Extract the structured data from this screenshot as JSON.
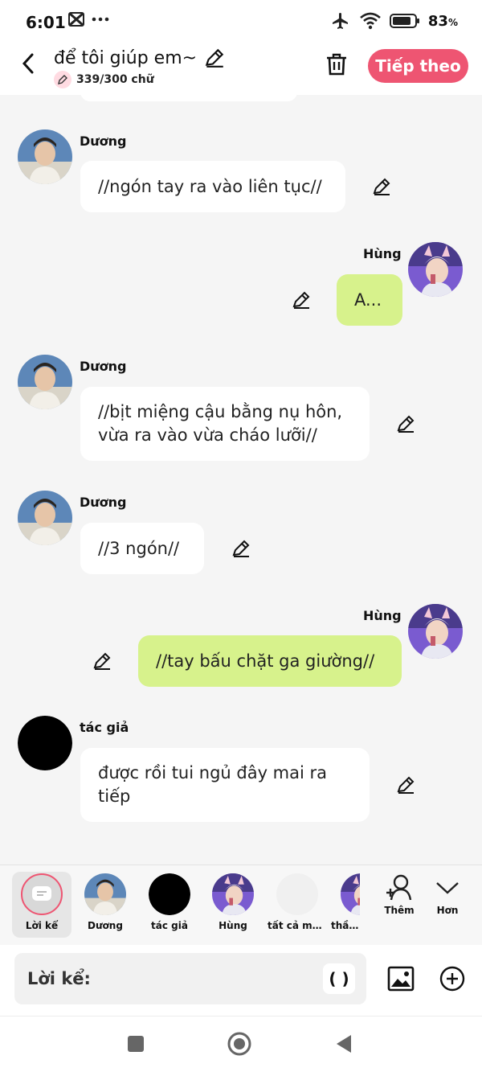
{
  "status": {
    "time": "6:01",
    "battery": "83",
    "battery_unit": "%",
    "icons": [
      "capcut-icon",
      "more-icon",
      "airplane-icon",
      "wifi-icon",
      "battery-icon"
    ]
  },
  "header": {
    "title": "để tôi giúp em~",
    "char_count": "339/300 chữ",
    "next_label": "Tiếp theo"
  },
  "messages": [
    {
      "sender": "Dương",
      "side": "left",
      "text": "//ngón tay ra vào liên tục//"
    },
    {
      "sender": "Hùng",
      "side": "right",
      "text": "A..."
    },
    {
      "sender": "Dương",
      "side": "left",
      "text": "//bịt miệng cậu bằng nụ hôn,\nvừa ra vào vừa cháo lưỡi//"
    },
    {
      "sender": "Dương",
      "side": "left",
      "text": "//3 ngón//"
    },
    {
      "sender": "Hùng",
      "side": "right",
      "text": "//tay bấu chặt ga giường//"
    },
    {
      "sender": "tác giả",
      "side": "left",
      "text": "được rồi tui ngủ đây mai ra\ntiếp"
    }
  ],
  "characters": [
    {
      "label": "Lời kể",
      "selected": true
    },
    {
      "label": "Dương"
    },
    {
      "label": "tác giả"
    },
    {
      "label": "Hùng"
    },
    {
      "label": "tất cả mọi..."
    },
    {
      "label": "thầy v"
    }
  ],
  "actions": {
    "add_label": "Thêm",
    "more_label": "Hơn"
  },
  "input": {
    "narration_label": "Lời kể:",
    "paren_label": "( )"
  },
  "colors": {
    "accent": "#ee5572",
    "right_bubble": "#d7f28c",
    "left_bubble": "#ffffff",
    "background": "#f5f5f5"
  }
}
